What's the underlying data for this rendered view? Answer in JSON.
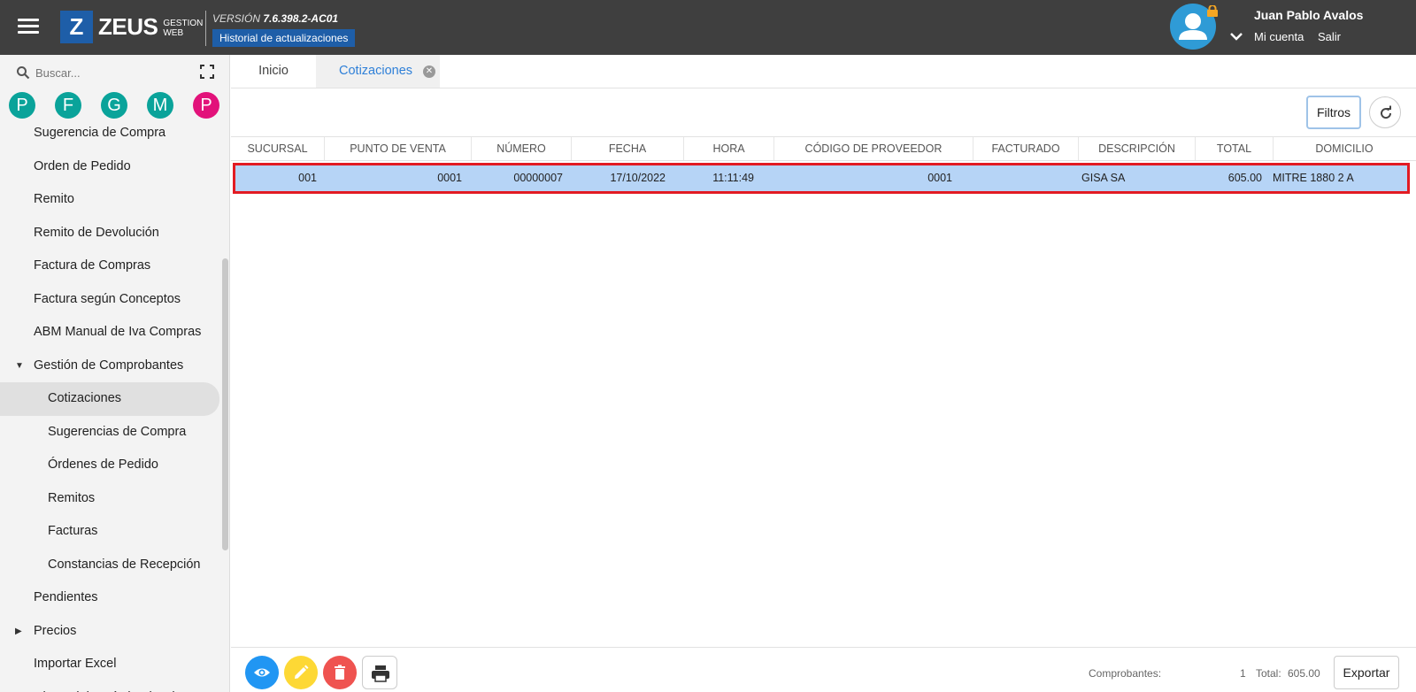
{
  "header": {
    "logo_letter": "Z",
    "logo_word": "ZEUS",
    "logo_sub_1": "GESTION",
    "logo_sub_2": "WEB",
    "version_label": "VERSIÓN",
    "version_number": "7.6.398.2-AC01",
    "history_button": "Historial de actualizaciones",
    "user_name": "Juan Pablo Avalos",
    "my_account": "Mi cuenta",
    "logout": "Salir"
  },
  "sidebar": {
    "search_placeholder": "Buscar...",
    "shortcuts": [
      {
        "letter": "P",
        "color": "#0aa39a"
      },
      {
        "letter": "F",
        "color": "#0aa39a"
      },
      {
        "letter": "G",
        "color": "#0aa39a"
      },
      {
        "letter": "M",
        "color": "#0aa39a"
      },
      {
        "letter": "P",
        "color": "#e2127a"
      }
    ],
    "items": [
      {
        "label": "Sugerencia de Compra",
        "level": 1
      },
      {
        "label": "Orden de Pedido",
        "level": 1
      },
      {
        "label": "Remito",
        "level": 1
      },
      {
        "label": "Remito de Devolución",
        "level": 1
      },
      {
        "label": "Factura de Compras",
        "level": 1
      },
      {
        "label": "Factura según Conceptos",
        "level": 1
      },
      {
        "label": "ABM Manual de Iva Compras",
        "level": 1
      },
      {
        "label": "Gestión de Comprobantes",
        "level": 1,
        "caret": "down"
      },
      {
        "label": "Cotizaciones",
        "level": 2,
        "active": true
      },
      {
        "label": "Sugerencias de Compra",
        "level": 2
      },
      {
        "label": "Órdenes de Pedido",
        "level": 2
      },
      {
        "label": "Remitos",
        "level": 2
      },
      {
        "label": "Facturas",
        "level": 2
      },
      {
        "label": "Constancias de Recepción",
        "level": 2
      },
      {
        "label": "Pendientes",
        "level": 1
      },
      {
        "label": "Precios",
        "level": 1,
        "caret": "right"
      },
      {
        "label": "Importar Excel",
        "level": 1
      },
      {
        "label": "Cierre del Período Fiscal",
        "level": 1
      }
    ]
  },
  "tabs": {
    "inicio": "Inicio",
    "cotizaciones": "Cotizaciones"
  },
  "toolbar": {
    "filters": "Filtros"
  },
  "table": {
    "columns": [
      "SUCURSAL",
      "PUNTO DE VENTA",
      "NÚMERO",
      "FECHA",
      "HORA",
      "CÓDIGO DE PROVEEDOR",
      "FACTURADO",
      "DESCRIPCIÓN",
      "TOTAL",
      "DOMICILIO"
    ],
    "rows": [
      {
        "sucursal": "001",
        "punto_venta": "0001",
        "numero": "00000007",
        "fecha": "17/10/2022",
        "hora": "11:11:49",
        "codigo_proveedor": "0001",
        "facturado": "",
        "descripcion": "GISA SA",
        "total": "605.00",
        "domicilio": "MITRE 1880 2 A"
      }
    ]
  },
  "footer": {
    "comprobantes_label": "Comprobantes:",
    "comprobantes_count": "1",
    "total_label": "Total:",
    "total_value": "605.00",
    "export": "Exportar"
  },
  "colors": {
    "topbar": "#3f3f3f",
    "brand_blue": "#1e5ea8",
    "view_button": "#2196f3",
    "edit_button": "#fdd835",
    "delete_button": "#ef5350",
    "selected_row": "#b6d4f6",
    "highlight_border": "#e21b23"
  }
}
